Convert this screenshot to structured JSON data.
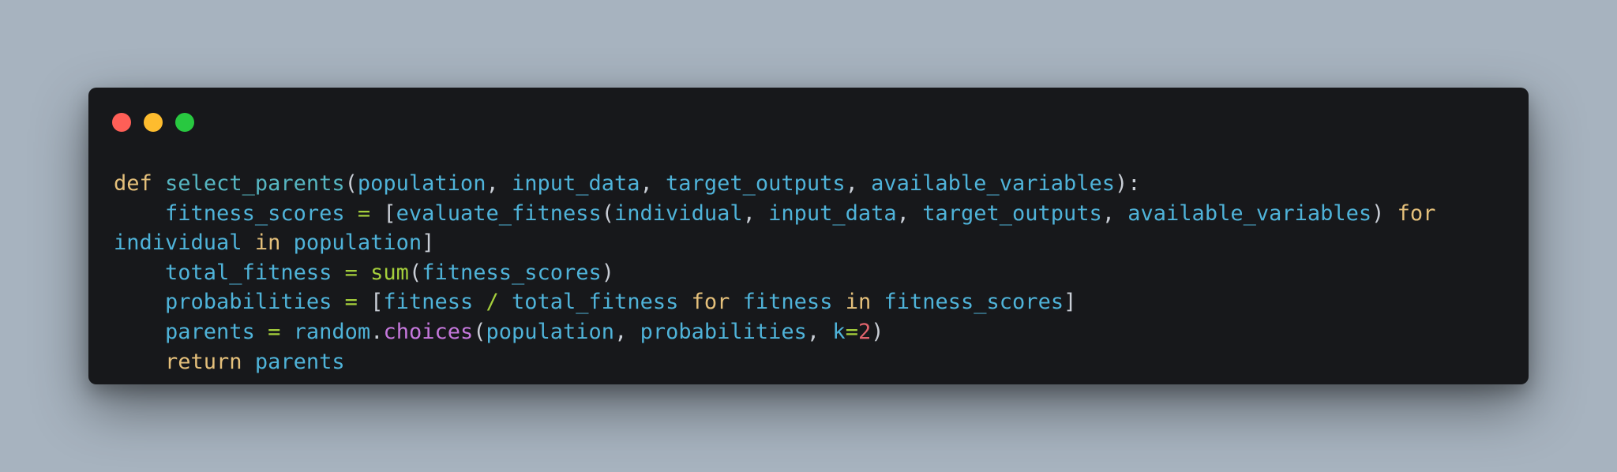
{
  "window": {
    "controls": [
      {
        "name": "close",
        "color": "#ff5f57"
      },
      {
        "name": "minimize",
        "color": "#febc2e"
      },
      {
        "name": "maximize",
        "color": "#28c840"
      }
    ]
  },
  "code": {
    "language": "python",
    "lines": [
      [
        {
          "t": "def",
          "c": "kw"
        },
        {
          "t": " "
        },
        {
          "t": "select_parents",
          "c": "fn"
        },
        {
          "t": "(",
          "c": "pn"
        },
        {
          "t": "population",
          "c": "id"
        },
        {
          "t": ", ",
          "c": "pn"
        },
        {
          "t": "input_data",
          "c": "id"
        },
        {
          "t": ", ",
          "c": "pn"
        },
        {
          "t": "target_outputs",
          "c": "id"
        },
        {
          "t": ", ",
          "c": "pn"
        },
        {
          "t": "available_variables",
          "c": "id"
        },
        {
          "t": "):",
          "c": "pn"
        }
      ],
      [
        {
          "t": "    "
        },
        {
          "t": "fitness_scores",
          "c": "id"
        },
        {
          "t": " "
        },
        {
          "t": "=",
          "c": "op"
        },
        {
          "t": " "
        },
        {
          "t": "[",
          "c": "pn"
        },
        {
          "t": "evaluate_fitness",
          "c": "id"
        },
        {
          "t": "(",
          "c": "pn"
        },
        {
          "t": "individual",
          "c": "id"
        },
        {
          "t": ", ",
          "c": "pn"
        },
        {
          "t": "input_data",
          "c": "id"
        },
        {
          "t": ", ",
          "c": "pn"
        },
        {
          "t": "target_outputs",
          "c": "id"
        },
        {
          "t": ", ",
          "c": "pn"
        },
        {
          "t": "available_variables",
          "c": "id"
        },
        {
          "t": ")",
          "c": "pn"
        },
        {
          "t": " "
        },
        {
          "t": "for",
          "c": "kw"
        }
      ],
      [
        {
          "t": "individual",
          "c": "id"
        },
        {
          "t": " "
        },
        {
          "t": "in",
          "c": "kw"
        },
        {
          "t": " "
        },
        {
          "t": "population",
          "c": "id"
        },
        {
          "t": "]",
          "c": "pn"
        }
      ],
      [
        {
          "t": "    "
        },
        {
          "t": "total_fitness",
          "c": "id"
        },
        {
          "t": " "
        },
        {
          "t": "=",
          "c": "op"
        },
        {
          "t": " "
        },
        {
          "t": "sum",
          "c": "bi"
        },
        {
          "t": "(",
          "c": "pn"
        },
        {
          "t": "fitness_scores",
          "c": "id"
        },
        {
          "t": ")",
          "c": "pn"
        }
      ],
      [
        {
          "t": "    "
        },
        {
          "t": "probabilities",
          "c": "id"
        },
        {
          "t": " "
        },
        {
          "t": "=",
          "c": "op"
        },
        {
          "t": " "
        },
        {
          "t": "[",
          "c": "pn"
        },
        {
          "t": "fitness",
          "c": "id"
        },
        {
          "t": " "
        },
        {
          "t": "/",
          "c": "op"
        },
        {
          "t": " "
        },
        {
          "t": "total_fitness",
          "c": "id"
        },
        {
          "t": " "
        },
        {
          "t": "for",
          "c": "kw"
        },
        {
          "t": " "
        },
        {
          "t": "fitness",
          "c": "id"
        },
        {
          "t": " "
        },
        {
          "t": "in",
          "c": "kw"
        },
        {
          "t": " "
        },
        {
          "t": "fitness_scores",
          "c": "id"
        },
        {
          "t": "]",
          "c": "pn"
        }
      ],
      [
        {
          "t": "    "
        },
        {
          "t": "parents",
          "c": "id"
        },
        {
          "t": " "
        },
        {
          "t": "=",
          "c": "op"
        },
        {
          "t": " "
        },
        {
          "t": "random",
          "c": "id"
        },
        {
          "t": ".",
          "c": "pn"
        },
        {
          "t": "choices",
          "c": "md"
        },
        {
          "t": "(",
          "c": "pn"
        },
        {
          "t": "population",
          "c": "id"
        },
        {
          "t": ", ",
          "c": "pn"
        },
        {
          "t": "probabilities",
          "c": "id"
        },
        {
          "t": ", ",
          "c": "pn"
        },
        {
          "t": "k",
          "c": "id"
        },
        {
          "t": "=",
          "c": "op"
        },
        {
          "t": "2",
          "c": "nm"
        },
        {
          "t": ")",
          "c": "pn"
        }
      ],
      [
        {
          "t": "    "
        },
        {
          "t": "return",
          "c": "kw"
        },
        {
          "t": " "
        },
        {
          "t": "parents",
          "c": "id"
        }
      ]
    ]
  }
}
